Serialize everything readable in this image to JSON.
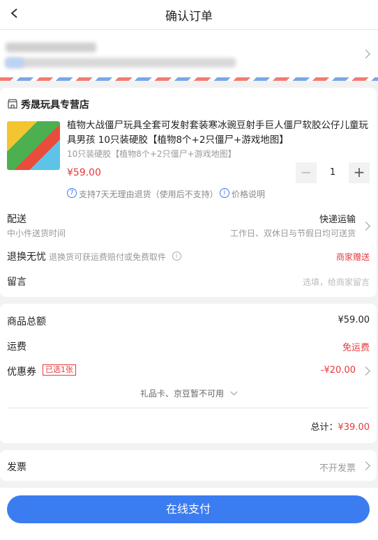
{
  "header": {
    "title": "确认订单"
  },
  "shop": {
    "name": "秀晟玩具专营店"
  },
  "product": {
    "title": "植物大战僵尸玩具全套可发射套装寒冰豌豆射手巨人僵尸软胶公仔儿童玩具男孩 10只装硬胶【植物8个+2只僵尸+游戏地图】",
    "spec": "10只装硬胶【植物8个+2只僵尸+游戏地图】",
    "price": "¥59.00",
    "qty": "1",
    "return_policy": "支持7天无理由退货（使用后不支持）",
    "price_note": "价格说明"
  },
  "delivery": {
    "label": "配送",
    "method": "快递运输",
    "sub_left": "中小件送货时间",
    "sub_right": "工作日、双休日与节假日均可送货"
  },
  "return": {
    "label": "退换无忧",
    "desc": "退换货可获运费赔付或免费取件",
    "badge": "商家赠送"
  },
  "message": {
    "label": "留言",
    "placeholder": "选填，给商家留言"
  },
  "summary": {
    "goods_label": "商品总额",
    "goods_value": "¥59.00",
    "freight_label": "运费",
    "freight_value": "免运费",
    "coupon_label": "优惠券",
    "coupon_tag": "已选1张",
    "coupon_value": "-¥20.00",
    "giftcard": "礼品卡、京豆暂不可用",
    "total_label": "总计：",
    "total_value": "¥39.00"
  },
  "invoice": {
    "label": "发票",
    "value": "不开发票"
  },
  "pay": {
    "label": "在线支付"
  },
  "colors": {
    "accent": "#e4393c",
    "primary": "#3b7cf0"
  }
}
